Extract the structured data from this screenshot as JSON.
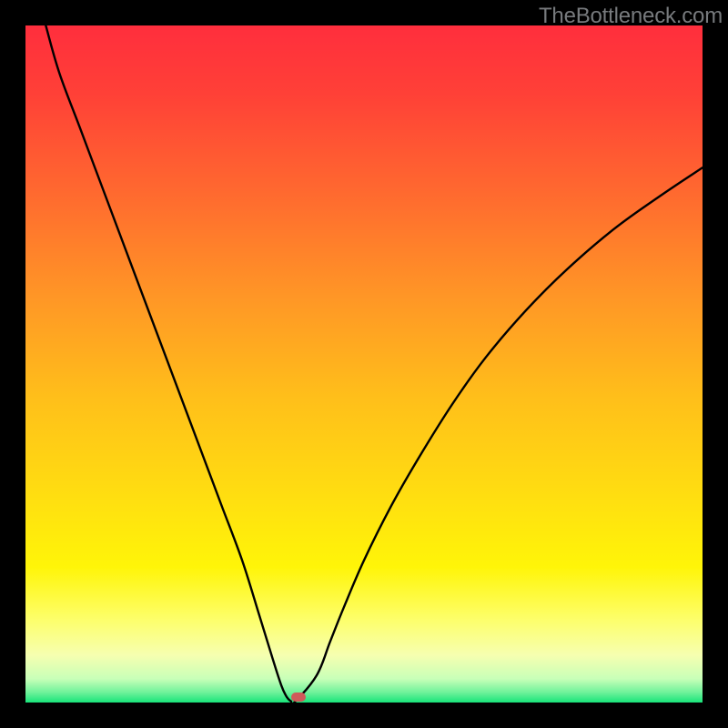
{
  "watermark": "TheBottleneck.com",
  "chart_data": {
    "type": "line",
    "title": "",
    "xlabel": "",
    "ylabel": "",
    "xlim": [
      0,
      100
    ],
    "ylim": [
      0,
      100
    ],
    "grid": false,
    "background_gradient": {
      "top_color": "#ff2e3d",
      "mid_color": "#ffd400",
      "near_bottom_color": "#fdff9f",
      "bottom_color": "#18e47a"
    },
    "series": [
      {
        "name": "bottleneck-curve",
        "color": "#000000",
        "x": [
          3,
          5,
          8,
          11,
          14,
          17,
          20,
          23,
          26,
          29,
          32,
          34.5,
          36.5,
          37.8,
          38.6,
          39.2,
          39.7,
          43,
          45,
          47,
          50,
          54,
          58,
          63,
          68,
          74,
          80,
          87,
          94,
          100
        ],
        "values": [
          100,
          93,
          85,
          77,
          69,
          61,
          53,
          45,
          37,
          29,
          21,
          13,
          6.5,
          2.5,
          0.8,
          0.2,
          0.0,
          4,
          9,
          14,
          21,
          29,
          36,
          44,
          51,
          58,
          64,
          70,
          75,
          79
        ]
      }
    ],
    "marker": {
      "name": "optimal-point",
      "x": 40.3,
      "y": 0.8,
      "color": "#cf5a5a"
    }
  }
}
